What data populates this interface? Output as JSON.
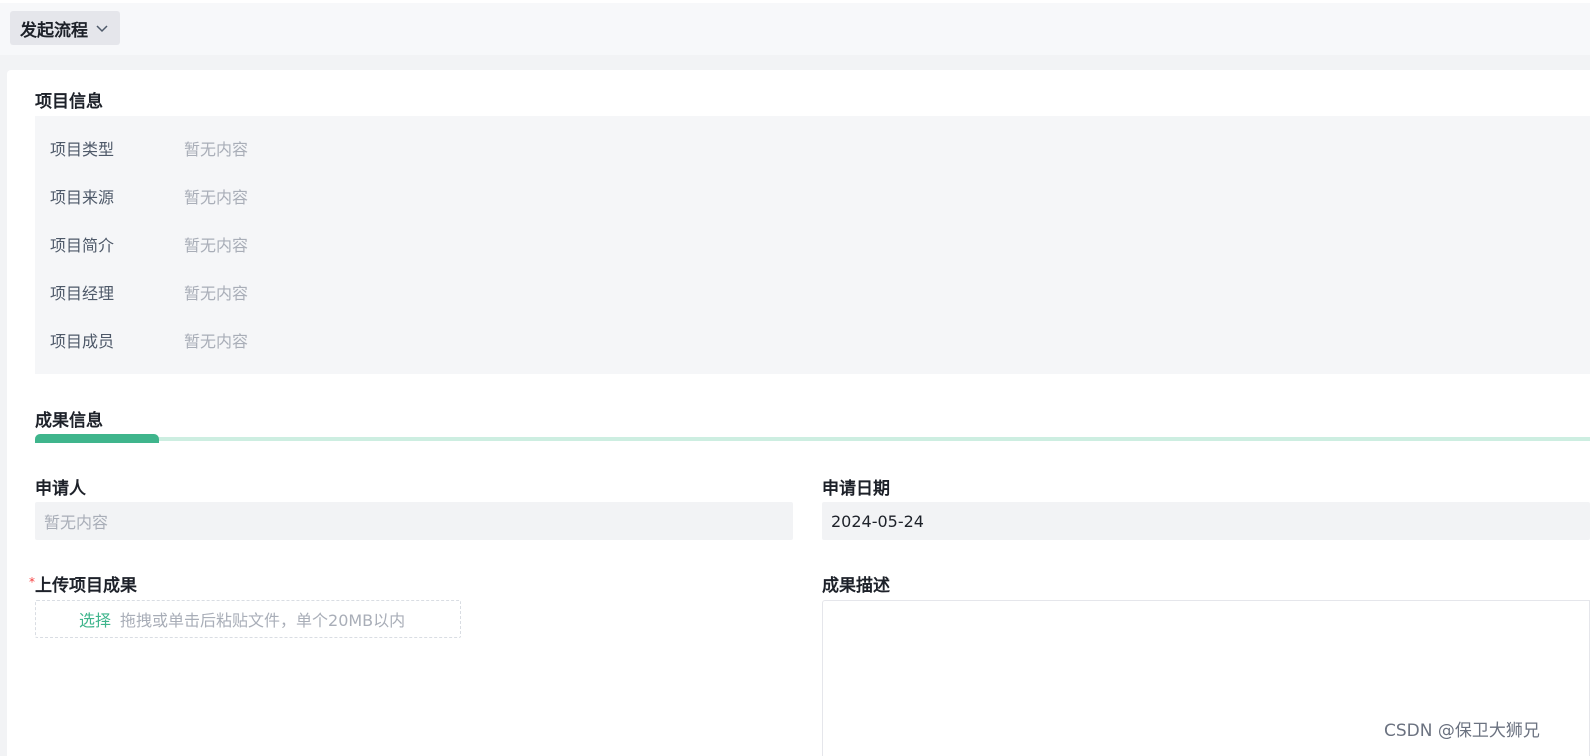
{
  "header": {
    "flow_button_label": "发起流程"
  },
  "project_info": {
    "title": "项目信息",
    "rows": [
      {
        "label": "项目类型",
        "value": "暂无内容"
      },
      {
        "label": "项目来源",
        "value": "暂无内容"
      },
      {
        "label": "项目简介",
        "value": "暂无内容"
      },
      {
        "label": "项目经理",
        "value": "暂无内容"
      },
      {
        "label": "项目成员",
        "value": "暂无内容"
      }
    ]
  },
  "result_info": {
    "title": "成果信息",
    "applicant": {
      "label": "申请人",
      "placeholder": "暂无内容"
    },
    "apply_date": {
      "label": "申请日期",
      "value": "2024-05-24"
    },
    "upload": {
      "required_mark": "*",
      "label": "上传项目成果",
      "select_label": "选择",
      "hint": "拖拽或单击后粘贴文件，单个20MB以内"
    },
    "description": {
      "label": "成果描述",
      "value": ""
    }
  },
  "watermark": "CSDN @保卫大狮兄",
  "colors": {
    "accent": "#3fb58c",
    "accent_light": "#cdeee1",
    "required": "#f53f3f",
    "field_bg": "#f2f3f5",
    "placeholder": "#a9aeb8"
  }
}
